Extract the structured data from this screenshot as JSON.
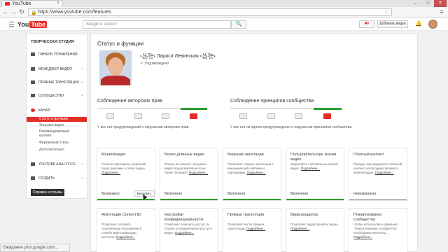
{
  "browser": {
    "tab_title": "YouTube",
    "tab_close": "×",
    "url": "https://www.youtube.com/features",
    "window_controls": [
      "–",
      "□",
      "✕"
    ],
    "extensions": [
      {
        "label": "ABP",
        "color": "#e52d27"
      },
      {
        "label": "✓",
        "color": "#2e9c2e"
      },
      {
        "label": "G",
        "color": "#4a7bd0"
      }
    ]
  },
  "header": {
    "logo_you": "You",
    "logo_tube": "Tube",
    "search_placeholder": "Введите запрос",
    "search_icon": "🔍",
    "video_button": "■▾",
    "add_video_label": "Добавить видео",
    "bell_icon": "🔔"
  },
  "sidebar": {
    "title": "ТВОРЧЕСКАЯ СТУДИЯ",
    "items": [
      {
        "label": "ПАНЕЛЬ УПРАВЛЕНИЯ",
        "chevron": ""
      },
      {
        "label": "МЕНЕДЖЕР ВИДЕО",
        "chevron": "⌄"
      },
      {
        "label": "ПРЯМЫЕ ТРАНСЛЯЦИИ",
        "chevron": "⌄"
      },
      {
        "label": "СООБЩЕСТВО",
        "chevron": "⌄"
      },
      {
        "label": "КАНАЛ",
        "chevron": ""
      }
    ],
    "channel_sub_active": "Статус и функции",
    "channel_subs": [
      "Загрузка видео",
      "Рекомендованный контент",
      "Фирменный стиль",
      "Дополнительно"
    ],
    "analytics_label": "YOUTUBE ANALYTICS",
    "create_label": "СОЗДАТЬ",
    "feedback_label": "Справка и отзывы"
  },
  "main": {
    "page_title": "Статус и функции",
    "channel_name": "꧁꧂ Лариса Левинская ꧁꧂",
    "verified_label": "Подтверждено",
    "copyright": {
      "title": "Соблюдение авторских прав",
      "status": "У вас нет предупреждений о нарушении авторских прав."
    },
    "community": {
      "title": "Соблюдение принципов сообщества",
      "status": "У вас нет ни одного предупреждения о нарушении принципов сообщества."
    },
    "cards_row1": [
      {
        "title": "Монетизация",
        "desc": "Станьте партнером, разрешив показ рекламы в своих видео.",
        "link": "Подробнее...",
        "status": "Возможно",
        "status_color": "#2e9c2e",
        "button": "Включить"
      },
      {
        "title": "Более длинные видео",
        "desc": "Теперь вы можете загружать видео продолжительностью более 15 минут!",
        "link": "Подробнее...",
        "status": "Включено",
        "status_color": "#2e9c2e",
        "button": ""
      },
      {
        "title": "Внешние аннотации",
        "desc": "Позволяет связать аннотации с внешними веб-сайтами и партнерами.",
        "link": "Подробнее...",
        "status": "Включено",
        "status_color": "#2e9c2e",
        "button": ""
      },
      {
        "title": "Пользовательские значки видео",
        "desc": "Загружайте собственные значки видео.",
        "link": "Подробнее...",
        "status": "Включено",
        "status_color": "#2e9c2e",
        "button": ""
      },
      {
        "title": "Платный контент",
        "desc": "Прежде чем предлагать платный контент, необходимо включить монетизацию.",
        "link": "Подробнее...",
        "status": "Невозможно",
        "status_color": "#bbbbbb",
        "button": ""
      }
    ],
    "cards_row2": [
      {
        "title": "Апелляции Content ID",
        "desc": "Позволяет оспорить отклоненные возражения в службе идентификации контента.",
        "link": "Подробнее..."
      },
      {
        "title": "Настройки конфиденциальности",
        "desc": "Позволяет включать доступ по ссылке и ограниченный доступ к видео.",
        "link": "Подробнее..."
      },
      {
        "title": "Прямые трансляции",
        "desc": "Позволяет вести прямые трансляции.",
        "link": "Подробнее..."
      },
      {
        "title": "Видеоредактор",
        "desc": "Позволяет редактировать видео.",
        "link": "Подробнее..."
      },
      {
        "title": "Пожертвования сообщества",
        "desc": "Чтобы использовать функцию \"Пожертвования сообщества\", необходимо включить…",
        "link": "Подробнее..."
      }
    ]
  },
  "statusbar": "Ожидание plus.google.com..."
}
